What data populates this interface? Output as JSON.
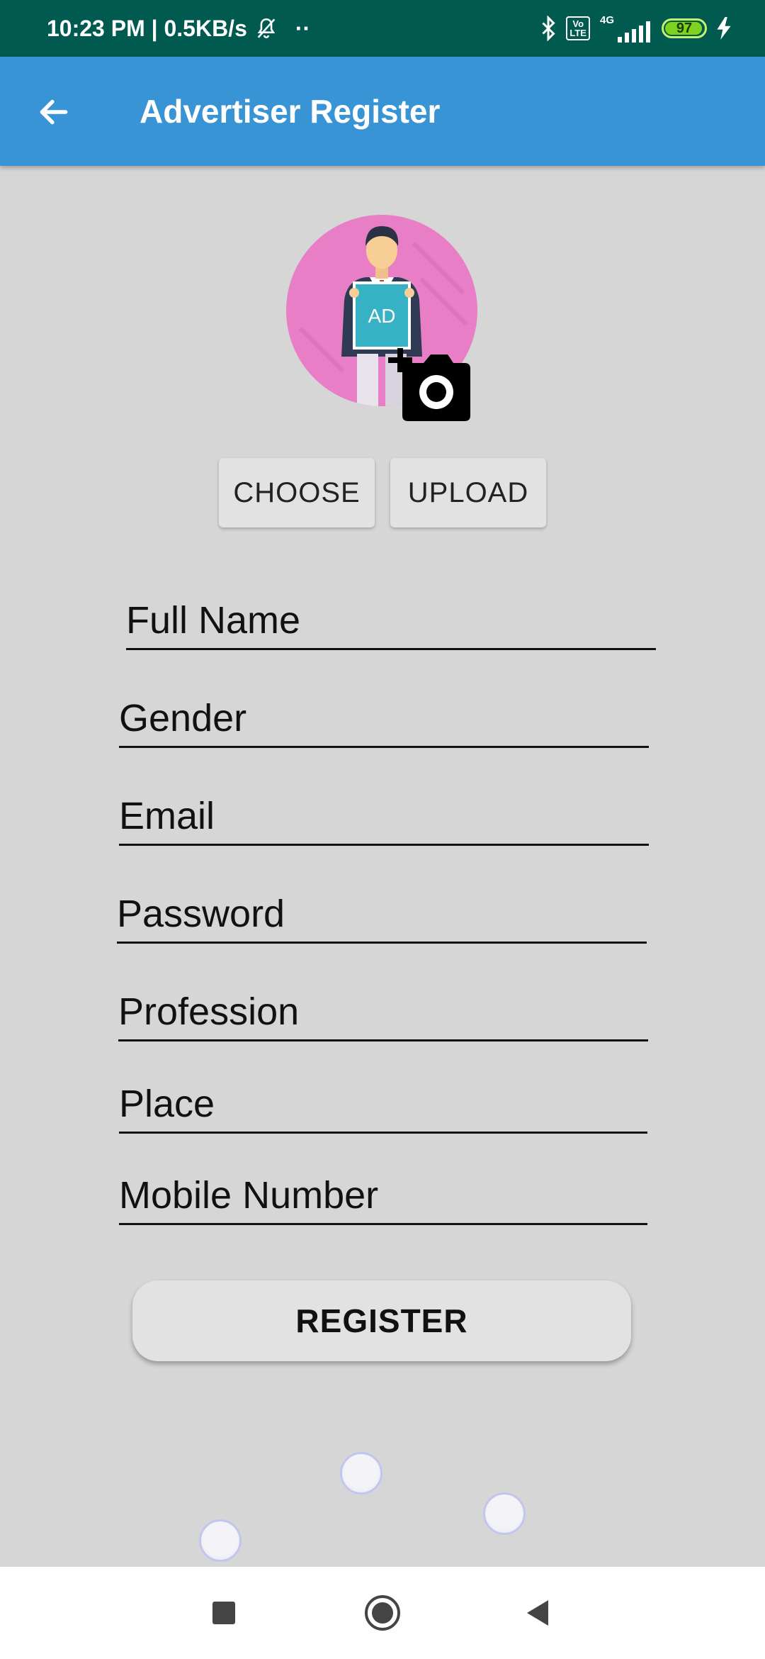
{
  "status_bar": {
    "time_speed": "10:23 PM | 0.5KB/s",
    "dots": "··",
    "volte_top": "Vo",
    "volte_bottom": "LTE",
    "network": "4G",
    "battery_level": "97"
  },
  "app_bar": {
    "title": "Advertiser Register",
    "color": "#3894d4"
  },
  "avatar": {
    "badge_text": "AD"
  },
  "photo_actions": {
    "choose_label": "CHOOSE",
    "upload_label": "UPLOAD"
  },
  "form": {
    "full_name": {
      "placeholder": "Full Name",
      "value": ""
    },
    "gender": {
      "placeholder": "Gender",
      "value": ""
    },
    "email": {
      "placeholder": "Email",
      "value": ""
    },
    "password": {
      "placeholder": "Password",
      "value": ""
    },
    "profession": {
      "placeholder": "Profession",
      "value": ""
    },
    "place": {
      "placeholder": "Place",
      "value": ""
    },
    "mobile_number": {
      "placeholder": "Mobile Number",
      "value": ""
    }
  },
  "register_label": "REGISTER",
  "nav": {
    "recents": "square-icon",
    "home": "circle-icon",
    "back": "triangle-icon"
  }
}
